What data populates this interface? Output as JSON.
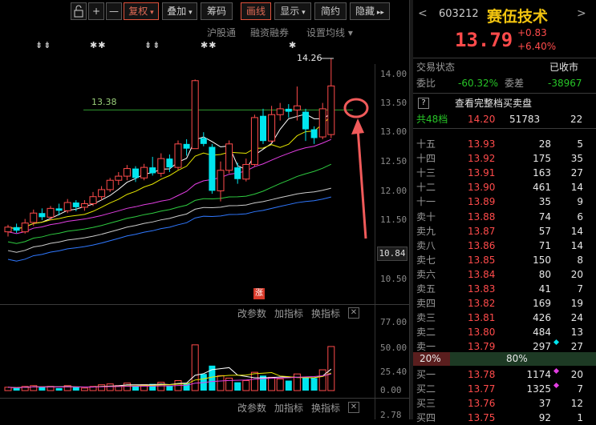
{
  "toolbar": {
    "buttons": [
      "+",
      "—",
      "复权",
      "叠加",
      "筹码",
      "画线",
      "显示",
      "简约",
      "隐藏"
    ]
  },
  "subbar": {
    "items": [
      "沪股通",
      "融资融券",
      "设置均线"
    ]
  },
  "chart": {
    "markers": [
      "⇟⇟",
      "✱✱",
      "⇟⇟",
      "✱✱",
      "✱"
    ],
    "high_label": "14.26",
    "level_label": "13.38",
    "current_price_tag": "10.84",
    "y_ticks": [
      "14.00",
      "13.50",
      "13.00",
      "12.50",
      "12.00",
      "11.50",
      "10.50"
    ],
    "zhang_badge": "涨",
    "indicator_bar": [
      "改参数",
      "加指标",
      "换指标"
    ],
    "volume_ticks": [
      "77.00",
      "50.00",
      "25.40",
      "0.00"
    ],
    "bottom_tick": "2.78"
  },
  "chart_data": {
    "type": "bar",
    "title": "",
    "candles": [
      {
        "o": 11.3,
        "c": 11.38,
        "h": 11.42,
        "l": 11.22
      },
      {
        "o": 11.38,
        "c": 11.32,
        "h": 11.44,
        "l": 11.28
      },
      {
        "o": 11.3,
        "c": 11.45,
        "h": 11.52,
        "l": 11.27
      },
      {
        "o": 11.46,
        "c": 11.62,
        "h": 11.68,
        "l": 11.4
      },
      {
        "o": 11.62,
        "c": 11.55,
        "h": 11.7,
        "l": 11.5
      },
      {
        "o": 11.55,
        "c": 11.7,
        "h": 11.74,
        "l": 11.5
      },
      {
        "o": 11.7,
        "c": 11.66,
        "h": 11.78,
        "l": 11.58
      },
      {
        "o": 11.66,
        "c": 11.8,
        "h": 11.86,
        "l": 11.62
      },
      {
        "o": 11.8,
        "c": 11.72,
        "h": 11.84,
        "l": 11.65
      },
      {
        "o": 11.72,
        "c": 11.78,
        "h": 11.84,
        "l": 11.66
      },
      {
        "o": 11.78,
        "c": 11.9,
        "h": 11.98,
        "l": 11.74
      },
      {
        "o": 11.9,
        "c": 12.02,
        "h": 12.08,
        "l": 11.84
      },
      {
        "o": 12.02,
        "c": 12.18,
        "h": 12.22,
        "l": 11.98
      },
      {
        "o": 12.18,
        "c": 12.25,
        "h": 12.32,
        "l": 12.1
      },
      {
        "o": 12.25,
        "c": 12.38,
        "h": 12.44,
        "l": 12.18
      },
      {
        "o": 12.38,
        "c": 12.22,
        "h": 12.42,
        "l": 12.15
      },
      {
        "o": 12.22,
        "c": 12.4,
        "h": 12.46,
        "l": 12.18
      },
      {
        "o": 12.4,
        "c": 12.3,
        "h": 12.58,
        "l": 12.26
      },
      {
        "o": 12.3,
        "c": 12.55,
        "h": 12.64,
        "l": 12.24
      },
      {
        "o": 12.55,
        "c": 12.4,
        "h": 12.62,
        "l": 12.32
      },
      {
        "o": 12.4,
        "c": 12.8,
        "h": 12.86,
        "l": 12.36
      },
      {
        "o": 12.8,
        "c": 12.72,
        "h": 12.88,
        "l": 12.6
      },
      {
        "o": 12.72,
        "c": 13.88,
        "h": 13.9,
        "l": 12.72
      },
      {
        "o": 12.9,
        "c": 12.8,
        "h": 13.0,
        "l": 12.76
      },
      {
        "o": 12.75,
        "c": 12.0,
        "h": 12.8,
        "l": 11.95
      },
      {
        "o": 12.0,
        "c": 12.35,
        "h": 12.5,
        "l": 11.82
      },
      {
        "o": 12.35,
        "c": 12.8,
        "h": 12.86,
        "l": 12.3
      },
      {
        "o": 12.4,
        "c": 12.2,
        "h": 12.48,
        "l": 12.12
      },
      {
        "o": 12.2,
        "c": 12.45,
        "h": 12.55,
        "l": 12.16
      },
      {
        "o": 12.45,
        "c": 13.25,
        "h": 13.3,
        "l": 12.42
      },
      {
        "o": 13.28,
        "c": 12.85,
        "h": 13.4,
        "l": 12.8
      },
      {
        "o": 12.85,
        "c": 13.3,
        "h": 13.45,
        "l": 12.82
      },
      {
        "o": 13.3,
        "c": 13.4,
        "h": 13.5,
        "l": 13.2
      },
      {
        "o": 13.4,
        "c": 13.35,
        "h": 13.48,
        "l": 13.25
      },
      {
        "o": 13.38,
        "c": 13.45,
        "h": 13.78,
        "l": 13.2
      },
      {
        "o": 13.35,
        "c": 13.05,
        "h": 13.4,
        "l": 12.85
      },
      {
        "o": 13.05,
        "c": 12.9,
        "h": 13.1,
        "l": 12.8
      },
      {
        "o": 12.92,
        "c": 13.4,
        "h": 13.5,
        "l": 12.88
      },
      {
        "o": 12.96,
        "c": 13.79,
        "h": 14.26,
        "l": 12.9
      }
    ],
    "y_range": [
      10.3,
      14.3
    ],
    "volume_range": [
      0,
      77
    ],
    "volumes": [
      4,
      3,
      5,
      6,
      4,
      5,
      3,
      6,
      4,
      3,
      5,
      7,
      8,
      6,
      9,
      5,
      7,
      8,
      10,
      6,
      12,
      9,
      55,
      20,
      30,
      18,
      15,
      10,
      12,
      22,
      18,
      16,
      14,
      12,
      20,
      16,
      15,
      25,
      53
    ],
    "volume_dir": [
      "u",
      "d",
      "u",
      "u",
      "d",
      "u",
      "d",
      "u",
      "d",
      "u",
      "u",
      "u",
      "u",
      "u",
      "u",
      "d",
      "u",
      "d",
      "u",
      "d",
      "u",
      "d",
      "u",
      "d",
      "d",
      "u",
      "u",
      "d",
      "u",
      "u",
      "d",
      "u",
      "u",
      "d",
      "u",
      "d",
      "d",
      "u",
      "u"
    ]
  },
  "quote": {
    "code": "603212",
    "name": "赛伍技术",
    "price": "13.79",
    "change": "+0.83",
    "pct": "+6.40%",
    "trade_status_label": "交易状态",
    "trade_status_value": "已收市",
    "weibi_label": "委比",
    "weibi_value": "-60.32%",
    "weicha_label": "委差",
    "weicha_value": "-38967",
    "question_mark": "?",
    "full_book_text": "查看完整档买卖盘",
    "total_label": "共48档",
    "total_price": "14.20",
    "total_vol": "51783",
    "total_cnt": "22",
    "ratio_left": "20%",
    "ratio_right": "80%",
    "asks": [
      {
        "label": "十五",
        "price": "13.93",
        "vol": "28",
        "cnt": "5"
      },
      {
        "label": "十四",
        "price": "13.92",
        "vol": "175",
        "cnt": "35"
      },
      {
        "label": "十三",
        "price": "13.91",
        "vol": "163",
        "cnt": "27"
      },
      {
        "label": "十二",
        "price": "13.90",
        "vol": "461",
        "cnt": "14"
      },
      {
        "label": "十一",
        "price": "13.89",
        "vol": "35",
        "cnt": "9"
      },
      {
        "label": "卖十",
        "price": "13.88",
        "vol": "74",
        "cnt": "6"
      },
      {
        "label": "卖九",
        "price": "13.87",
        "vol": "57",
        "cnt": "14"
      },
      {
        "label": "卖八",
        "price": "13.86",
        "vol": "71",
        "cnt": "14"
      },
      {
        "label": "卖七",
        "price": "13.85",
        "vol": "150",
        "cnt": "8"
      },
      {
        "label": "卖六",
        "price": "13.84",
        "vol": "80",
        "cnt": "20"
      },
      {
        "label": "卖五",
        "price": "13.83",
        "vol": "41",
        "cnt": "7"
      },
      {
        "label": "卖四",
        "price": "13.82",
        "vol": "169",
        "cnt": "19"
      },
      {
        "label": "卖三",
        "price": "13.81",
        "vol": "426",
        "cnt": "24"
      },
      {
        "label": "卖二",
        "price": "13.80",
        "vol": "484",
        "cnt": "13"
      },
      {
        "label": "卖一",
        "price": "13.79",
        "vol": "297",
        "cnt": "27"
      }
    ],
    "bids": [
      {
        "label": "买一",
        "price": "13.78",
        "vol": "1174",
        "cnt": "20"
      },
      {
        "label": "买二",
        "price": "13.77",
        "vol": "1325",
        "cnt": "7"
      },
      {
        "label": "买三",
        "price": "13.76",
        "vol": "37",
        "cnt": "12"
      },
      {
        "label": "买四",
        "price": "13.75",
        "vol": "92",
        "cnt": "1"
      }
    ]
  },
  "colors": {
    "up": "#ff4b4b",
    "down": "#00e5ee",
    "accent": "#e0533e",
    "annot": "#f05a5a"
  }
}
